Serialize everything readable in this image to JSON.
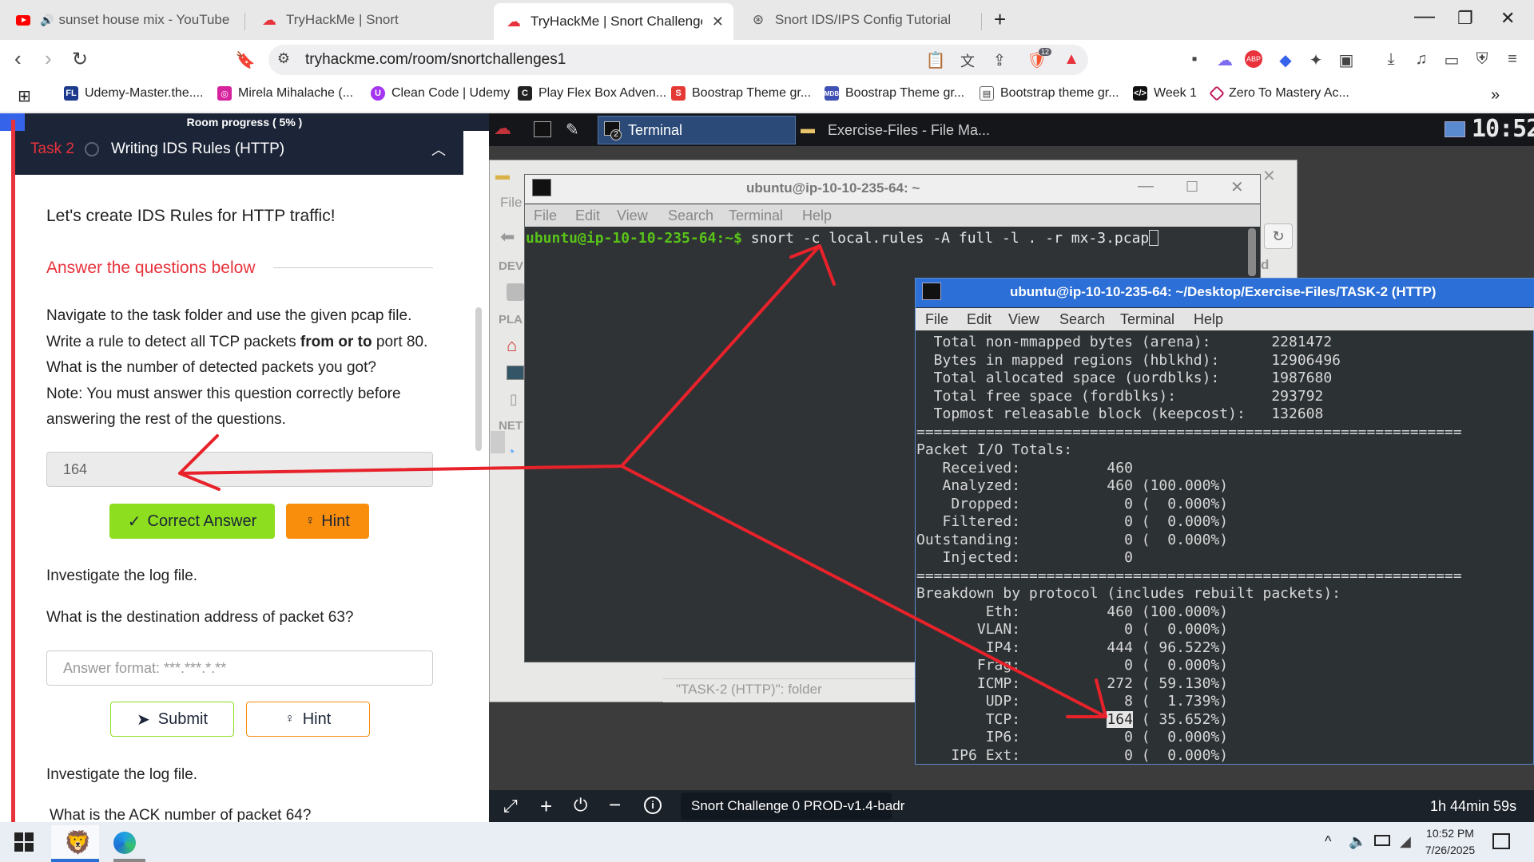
{
  "browser": {
    "tabs": [
      {
        "title": "sunset house mix - YouTube",
        "icon": "youtube-icon"
      },
      {
        "title": "TryHackMe | Snort",
        "icon": "tryhackme-icon"
      },
      {
        "title": "TryHackMe | Snort Challenge - Th",
        "icon": "tryhackme-icon",
        "active": true
      },
      {
        "title": "Snort IDS/IPS Config Tutorial",
        "icon": "chatgpt-icon"
      }
    ],
    "url": "tryhackme.com/room/snortchallenges1",
    "extension_badge": "12",
    "bookmarks": [
      "Udemy-Master.the....",
      "Mirela Mihalache (...",
      "Clean Code | Udemy",
      "Play Flex Box Adven...",
      "Boostrap Theme gr...",
      "Boostrap Theme gr...",
      "Bootstrap theme gr...",
      "Week 1",
      "Zero To Mastery Ac..."
    ]
  },
  "room": {
    "progress_label": "Room progress ( 5% )",
    "progress_pct": 5,
    "task_label": "Task 2",
    "task_title": "Writing IDS Rules (HTTP)",
    "intro": "Let's create IDS Rules for HTTP traffic!",
    "answer_heading": "Answer the questions below",
    "q1": {
      "line1": "Navigate to the task folder and use the given pcap file.",
      "line2a": "Write a rule to detect all TCP packets ",
      "line2b": "from or to",
      "line2c": " port 80.",
      "line3": "What is the number of detected packets you got?",
      "line4": "Note: You must answer this question correctly before",
      "line5": "answering the rest of the questions.",
      "answer": "164",
      "correct_label": "Correct Answer",
      "hint_label": "Hint"
    },
    "q2": {
      "intro": "Investigate the log file.",
      "question": "What is the destination address of packet 63?",
      "placeholder": "Answer format: ***.***.*.**",
      "submit_label": "Submit",
      "hint_label": "Hint"
    },
    "q3": {
      "intro": "Investigate the log file.",
      "question": "What is the ACK number of packet 64?"
    }
  },
  "vm": {
    "taskbar_items": [
      "Terminal",
      "Exercise-Files - File Ma..."
    ],
    "taskbar_badge": "2",
    "clock": "10:52",
    "filemanager_sidebar": [
      "File",
      "DEV",
      "PLA",
      "NET"
    ],
    "filemanager_status": "\"TASK-2 (HTTP)\": folder",
    "term1": {
      "title": "ubuntu@ip-10-10-235-64: ~",
      "menu": [
        "File",
        "Edit",
        "View",
        "Search",
        "Terminal",
        "Help"
      ],
      "prompt": "ubuntu@ip-10-10-235-64:~$",
      "command": " snort -c local.rules -A full -l . -r mx-3.pcap"
    },
    "term2": {
      "title": "ubuntu@ip-10-10-235-64: ~/Desktop/Exercise-Files/TASK-2 (HTTP)",
      "menu": [
        "File",
        "Edit",
        "View",
        "Search",
        "Terminal",
        "Help"
      ],
      "lines": [
        "  Total non-mmapped bytes (arena):       2281472",
        "  Bytes in mapped regions (hblkhd):      12906496",
        "  Total allocated space (uordblks):      1987680",
        "  Total free space (fordblks):           293792",
        "  Topmost releasable block (keepcost):   132608",
        "===============================================================",
        "Packet I/O Totals:",
        "   Received:          460",
        "   Analyzed:          460 (100.000%)",
        "    Dropped:            0 (  0.000%)",
        "   Filtered:            0 (  0.000%)",
        "Outstanding:            0 (  0.000%)",
        "   Injected:            0",
        "===============================================================",
        "Breakdown by protocol (includes rebuilt packets):",
        "        Eth:          460 (100.000%)",
        "       VLAN:            0 (  0.000%)",
        "        IP4:          444 ( 96.522%)",
        "       Frag:            0 (  0.000%)",
        "       ICMP:          272 ( 59.130%)",
        "        UDP:            8 (  1.739%)",
        "        TCP:          ",
        "        IP6:            0 (  0.000%)",
        "    IP6 Ext:            0 (  0.000%)"
      ],
      "tcp_highlight": "164",
      "tcp_rest": " ( 35.652%)"
    },
    "status_session": "Snort Challenge 0 PROD-v1.4-badr",
    "status_timer": "1h 44min 59s"
  },
  "windows": {
    "time": "10:52 PM",
    "date": "7/26/2025"
  },
  "colors": {
    "thm_red": "#e8323c",
    "thm_navy": "#1c2538",
    "correct_green": "#8cde1f",
    "hint_orange": "#f98e0c",
    "annotation_red": "#e8222a"
  }
}
